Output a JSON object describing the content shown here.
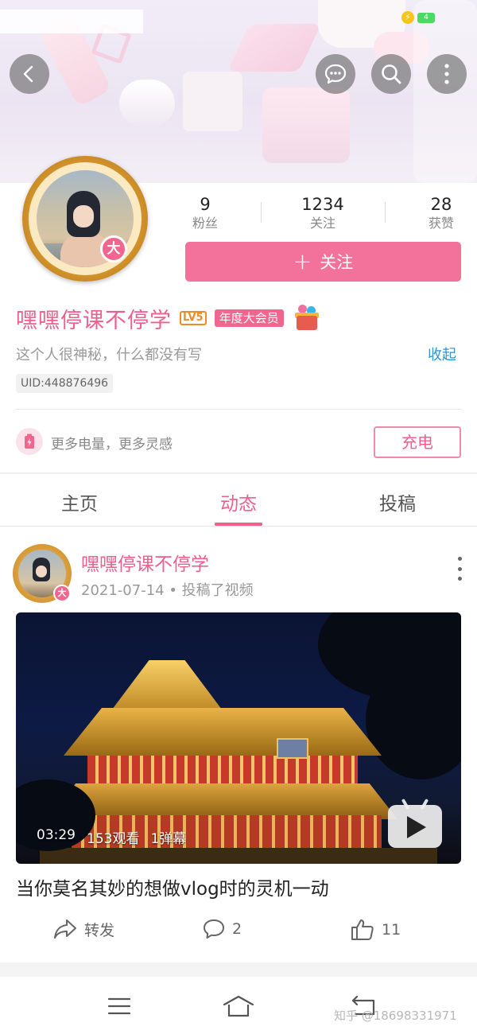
{
  "status_bar": {
    "battery_level": "4"
  },
  "header": {
    "back_icon": "back-arrow-icon",
    "message_icon": "chat-bubble-icon",
    "search_icon": "search-icon",
    "more_icon": "more-vertical-icon"
  },
  "profile": {
    "avatar_badge": "大",
    "stats": [
      {
        "value": "9",
        "label": "粉丝"
      },
      {
        "value": "1234",
        "label": "关注"
      },
      {
        "value": "28",
        "label": "获赞"
      }
    ],
    "follow_button": {
      "icon": "+",
      "label": "关注"
    },
    "name": "嘿嘿停课不停学",
    "level": "LV5",
    "vip_badge": "年度大会员",
    "bio": "这个人很神秘，什么都没有写",
    "collapse_label": "收起",
    "uid": "UID:448876496"
  },
  "charge": {
    "text": "更多电量，更多灵感",
    "button_label": "充电"
  },
  "tabs": [
    {
      "label": "主页",
      "active": false
    },
    {
      "label": "动态",
      "active": true
    },
    {
      "label": "投稿",
      "active": false
    }
  ],
  "post": {
    "author": "嘿嘿停课不停学",
    "avatar_badge": "大",
    "meta": "2021-07-14 • 投稿了视频",
    "video": {
      "duration": "03:29",
      "views": "153观看",
      "danmaku": "1弹幕"
    },
    "title": "当你莫名其妙的想做vlog时的灵机一动",
    "actions": {
      "share_label": "转发",
      "comment_count": "2",
      "like_count": "11"
    }
  },
  "watermark": "知乎 @18698331971",
  "colors": {
    "accent": "#f3729c",
    "link": "#2b95d6",
    "level": "#f08c26"
  }
}
